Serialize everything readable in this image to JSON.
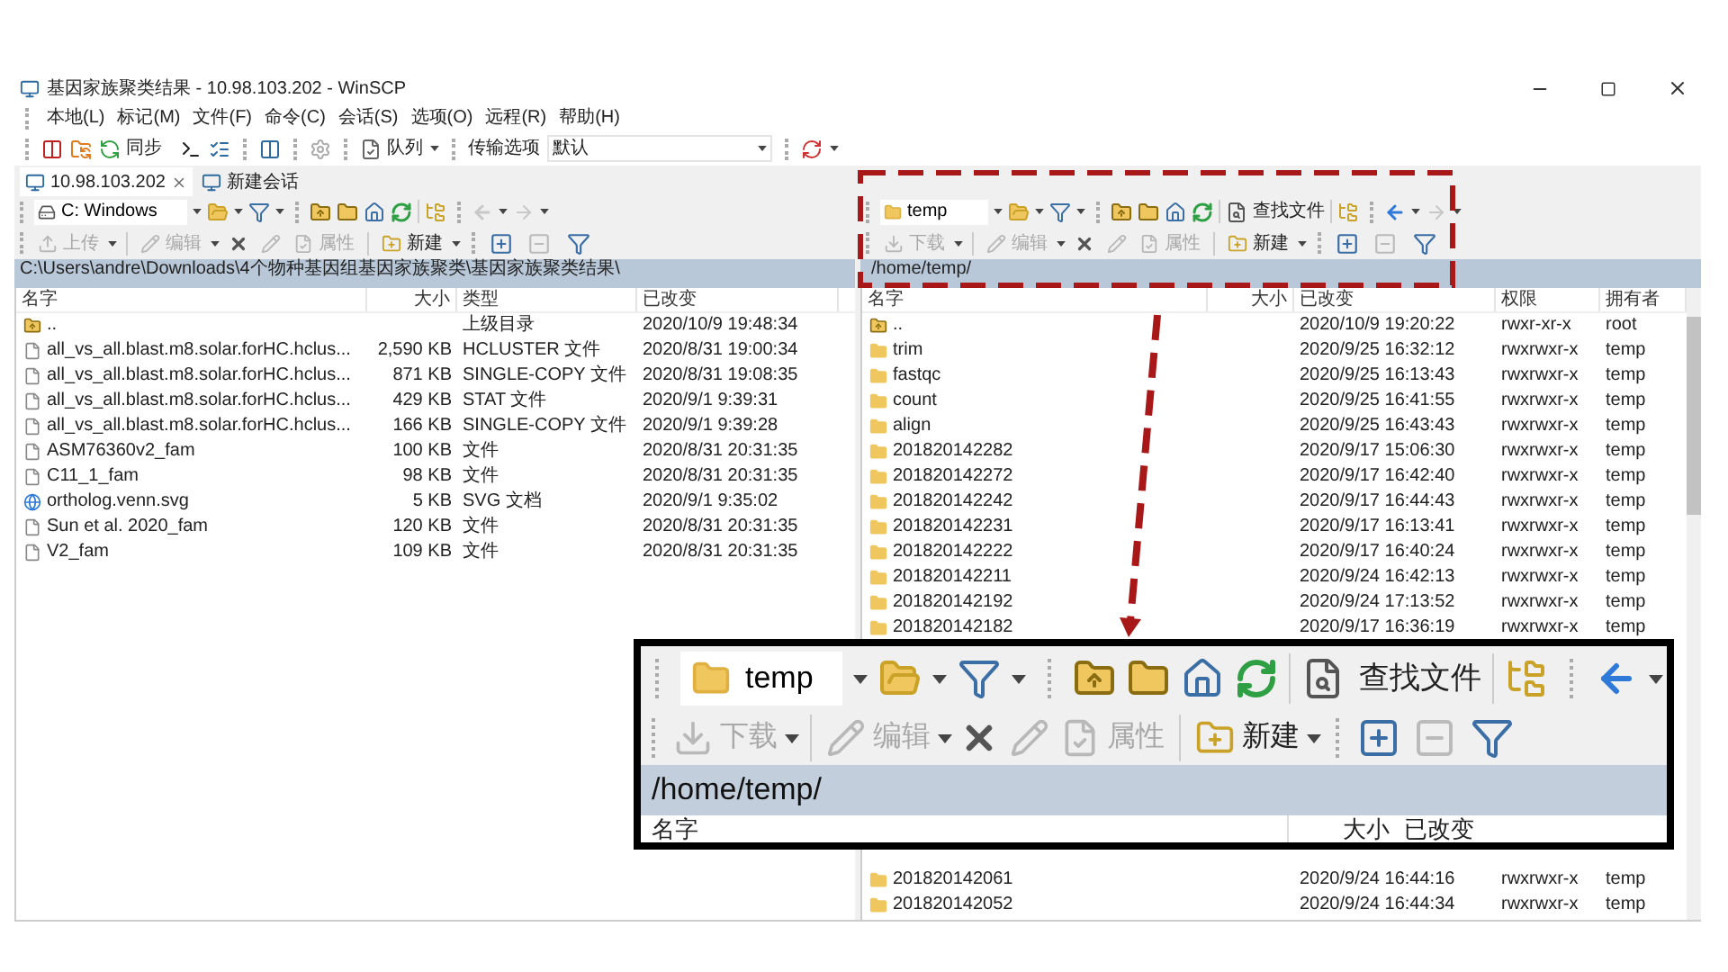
{
  "window": {
    "title": "基因家族聚类结果 - 10.98.103.202 - WinSCP"
  },
  "menu": [
    "本地(L)",
    "标记(M)",
    "文件(F)",
    "命令(C)",
    "会话(S)",
    "选项(O)",
    "远程(R)",
    "帮助(H)"
  ],
  "toolbar": {
    "sync": "同步",
    "queue": "队列",
    "transfer_label": "传输选项",
    "transfer_value": "默认"
  },
  "session_tabs": [
    {
      "label": "10.98.103.202",
      "selected": true
    },
    {
      "label": "新建会话",
      "selected": false
    }
  ],
  "left_pane": {
    "location": "C: Windows",
    "actions": [
      {
        "kind": "upload",
        "label": "上传",
        "disabled": true
      },
      {
        "kind": "edit",
        "label": "编辑",
        "disabled": true
      },
      {
        "kind": "delete",
        "disabled": false
      },
      {
        "kind": "rename",
        "disabled": true
      },
      {
        "kind": "properties",
        "label": "属性",
        "disabled": true
      },
      {
        "kind": "new",
        "label": "新建",
        "disabled": false
      }
    ],
    "path": "C:\\Users\\andre\\Downloads\\4个物种基因组基因家族聚类\\基因家族聚类结果\\",
    "columns": [
      "名字",
      "大小",
      "类型",
      "已改变"
    ],
    "rows": [
      {
        "kind": "parent",
        "name": "..",
        "type": "上级目录",
        "modified": "2020/10/9  19:48:34"
      },
      {
        "kind": "file",
        "name": "all_vs_all.blast.m8.solar.forHC.hclus...",
        "size": "2,590 KB",
        "type": "HCLUSTER 文件",
        "modified": "2020/8/31  19:00:34"
      },
      {
        "kind": "file",
        "name": "all_vs_all.blast.m8.solar.forHC.hclus...",
        "size": "871 KB",
        "type": "SINGLE-COPY 文件",
        "modified": "2020/8/31  19:08:35"
      },
      {
        "kind": "file",
        "name": "all_vs_all.blast.m8.solar.forHC.hclus...",
        "size": "429 KB",
        "type": "STAT 文件",
        "modified": "2020/9/1  9:39:31"
      },
      {
        "kind": "file",
        "name": "all_vs_all.blast.m8.solar.forHC.hclus...",
        "size": "166 KB",
        "type": "SINGLE-COPY 文件",
        "modified": "2020/9/1  9:39:28"
      },
      {
        "kind": "file",
        "name": "ASM76360v2_fam",
        "size": "100 KB",
        "type": "文件",
        "modified": "2020/8/31  20:31:35"
      },
      {
        "kind": "file",
        "name": "C11_1_fam",
        "size": "98 KB",
        "type": "文件",
        "modified": "2020/8/31  20:31:35"
      },
      {
        "kind": "svg",
        "name": "ortholog.venn.svg",
        "size": "5 KB",
        "type": "SVG 文档",
        "modified": "2020/9/1  9:35:02"
      },
      {
        "kind": "file",
        "name": "Sun et al. 2020_fam",
        "size": "120 KB",
        "type": "文件",
        "modified": "2020/8/31  20:31:35"
      },
      {
        "kind": "file",
        "name": "V2_fam",
        "size": "109 KB",
        "type": "文件",
        "modified": "2020/8/31  20:31:35"
      }
    ]
  },
  "right_pane": {
    "location": "temp",
    "find": "查找文件",
    "actions": [
      {
        "kind": "download",
        "label": "下载",
        "disabled": true
      },
      {
        "kind": "edit",
        "label": "编辑",
        "disabled": true
      },
      {
        "kind": "delete",
        "disabled": false
      },
      {
        "kind": "rename",
        "disabled": true
      },
      {
        "kind": "properties",
        "label": "属性",
        "disabled": true
      },
      {
        "kind": "new",
        "label": "新建",
        "disabled": false
      }
    ],
    "path": "/home/temp/",
    "columns": [
      "名字",
      "大小",
      "已改变",
      "权限",
      "拥有者"
    ],
    "rows": [
      {
        "kind": "parent",
        "name": "..",
        "modified": "2020/10/9 19:20:22",
        "rights": "rwxr-xr-x",
        "owner": "root"
      },
      {
        "kind": "folder",
        "name": "trim",
        "modified": "2020/9/25 16:32:12",
        "rights": "rwxrwxr-x",
        "owner": "temp"
      },
      {
        "kind": "folder",
        "name": "fastqc",
        "modified": "2020/9/25 16:13:43",
        "rights": "rwxrwxr-x",
        "owner": "temp"
      },
      {
        "kind": "folder",
        "name": "count",
        "modified": "2020/9/25 16:41:55",
        "rights": "rwxrwxr-x",
        "owner": "temp"
      },
      {
        "kind": "folder",
        "name": "align",
        "modified": "2020/9/25 16:43:43",
        "rights": "rwxrwxr-x",
        "owner": "temp"
      },
      {
        "kind": "folder",
        "name": "201820142282",
        "modified": "2020/9/17 15:06:30",
        "rights": "rwxrwxr-x",
        "owner": "temp"
      },
      {
        "kind": "folder",
        "name": "201820142272",
        "modified": "2020/9/17 16:42:40",
        "rights": "rwxrwxr-x",
        "owner": "temp"
      },
      {
        "kind": "folder",
        "name": "201820142242",
        "modified": "2020/9/17 16:44:43",
        "rights": "rwxrwxr-x",
        "owner": "temp"
      },
      {
        "kind": "folder",
        "name": "201820142231",
        "modified": "2020/9/17 16:13:41",
        "rights": "rwxrwxr-x",
        "owner": "temp"
      },
      {
        "kind": "folder",
        "name": "201820142222",
        "modified": "2020/9/17 16:40:24",
        "rights": "rwxrwxr-x",
        "owner": "temp"
      },
      {
        "kind": "folder",
        "name": "201820142211",
        "modified": "2020/9/24 16:42:13",
        "rights": "rwxrwxr-x",
        "owner": "temp"
      },
      {
        "kind": "folder",
        "name": "201820142192",
        "modified": "2020/9/24 17:13:52",
        "rights": "rwxrwxr-x",
        "owner": "temp"
      },
      {
        "kind": "folder",
        "name": "201820142182",
        "modified": "2020/9/17 16:36:19",
        "rights": "rwxrwxr-x",
        "owner": "temp"
      }
    ],
    "rows_below": [
      {
        "kind": "folder",
        "name": "201820142061",
        "modified": "2020/9/24 16:44:16",
        "rights": "rwxrwxr-x",
        "owner": "temp"
      },
      {
        "kind": "folder",
        "name": "201820142052",
        "modified": "2020/9/24 16:44:34",
        "rights": "rwxrwxr-x",
        "owner": "temp"
      }
    ]
  },
  "callout": {
    "location": "temp",
    "find": "查找文件",
    "actions": [
      {
        "kind": "download",
        "label": "下载",
        "disabled": true
      },
      {
        "kind": "edit",
        "label": "编辑",
        "disabled": true
      },
      {
        "kind": "delete",
        "disabled": false
      },
      {
        "kind": "rename",
        "disabled": true
      },
      {
        "kind": "properties",
        "label": "属性",
        "disabled": true
      },
      {
        "kind": "new",
        "label": "新建",
        "disabled": false
      }
    ],
    "path": "/home/temp/",
    "columns": [
      "名字",
      "大小",
      "已改变"
    ]
  }
}
